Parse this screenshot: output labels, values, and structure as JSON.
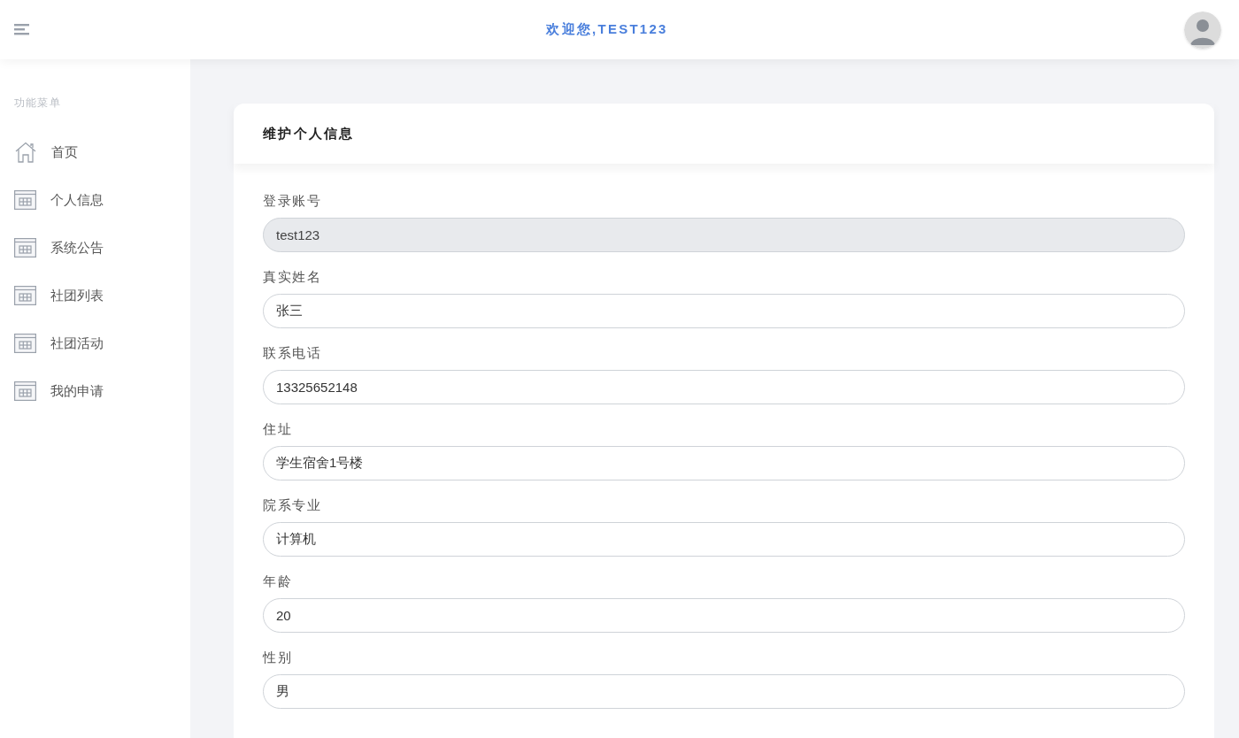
{
  "header": {
    "welcome": "欢迎您,TEST123"
  },
  "sidebar": {
    "heading": "功能菜单",
    "items": [
      {
        "label": "首页",
        "kind": "home"
      },
      {
        "label": "个人信息",
        "kind": "page"
      },
      {
        "label": "系统公告",
        "kind": "page"
      },
      {
        "label": "社团列表",
        "kind": "page"
      },
      {
        "label": "社团活动",
        "kind": "page"
      },
      {
        "label": "我的申请",
        "kind": "page"
      }
    ]
  },
  "form": {
    "title": "维护个人信息",
    "fields": [
      {
        "label": "登录账号",
        "value": "test123",
        "disabled": true
      },
      {
        "label": "真实姓名",
        "value": "张三",
        "disabled": false
      },
      {
        "label": "联系电话",
        "value": "13325652148",
        "disabled": false
      },
      {
        "label": "住址",
        "value": "学生宿舍1号楼",
        "disabled": false
      },
      {
        "label": "院系专业",
        "value": "计算机",
        "disabled": false
      },
      {
        "label": "年龄",
        "value": "20",
        "disabled": false
      },
      {
        "label": "性别",
        "value": "男",
        "disabled": false
      }
    ]
  }
}
